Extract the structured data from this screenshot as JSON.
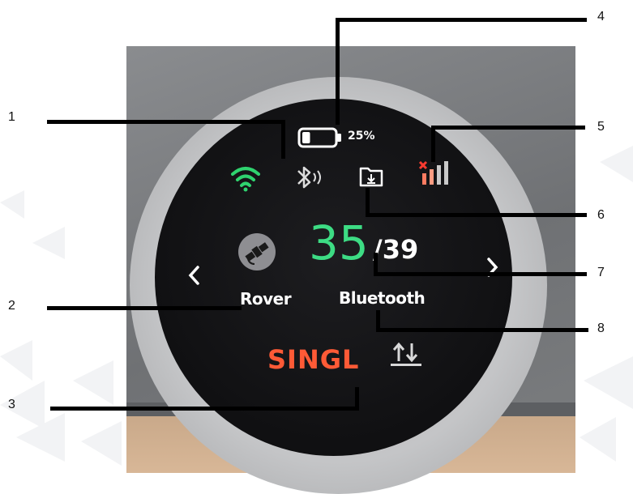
{
  "device": {
    "battery_percent_label": "25%",
    "battery_level": 0.25,
    "satellites_used": "35",
    "satellites_total": "/39",
    "mode_label": "Rover",
    "connection_label": "Bluetooth",
    "solution_status": "SINGL",
    "icons": {
      "wifi": "wifi-icon",
      "bluetooth": "bluetooth-icon",
      "download": "download-folder-icon",
      "cellular": "cellular-no-signal-icon",
      "battery": "battery-icon",
      "satellite": "satellite-icon",
      "nav_left": "chevron-left-icon",
      "nav_right": "chevron-right-icon",
      "transfer": "up-down-transfer-icon"
    },
    "colors": {
      "satellites": "#3ddc84",
      "wifi": "#2fd36f",
      "status": "#ff5a36",
      "cellular_error": "#ff3b30"
    }
  },
  "callouts": [
    "1",
    "2",
    "3",
    "4",
    "5",
    "6",
    "7",
    "8"
  ]
}
